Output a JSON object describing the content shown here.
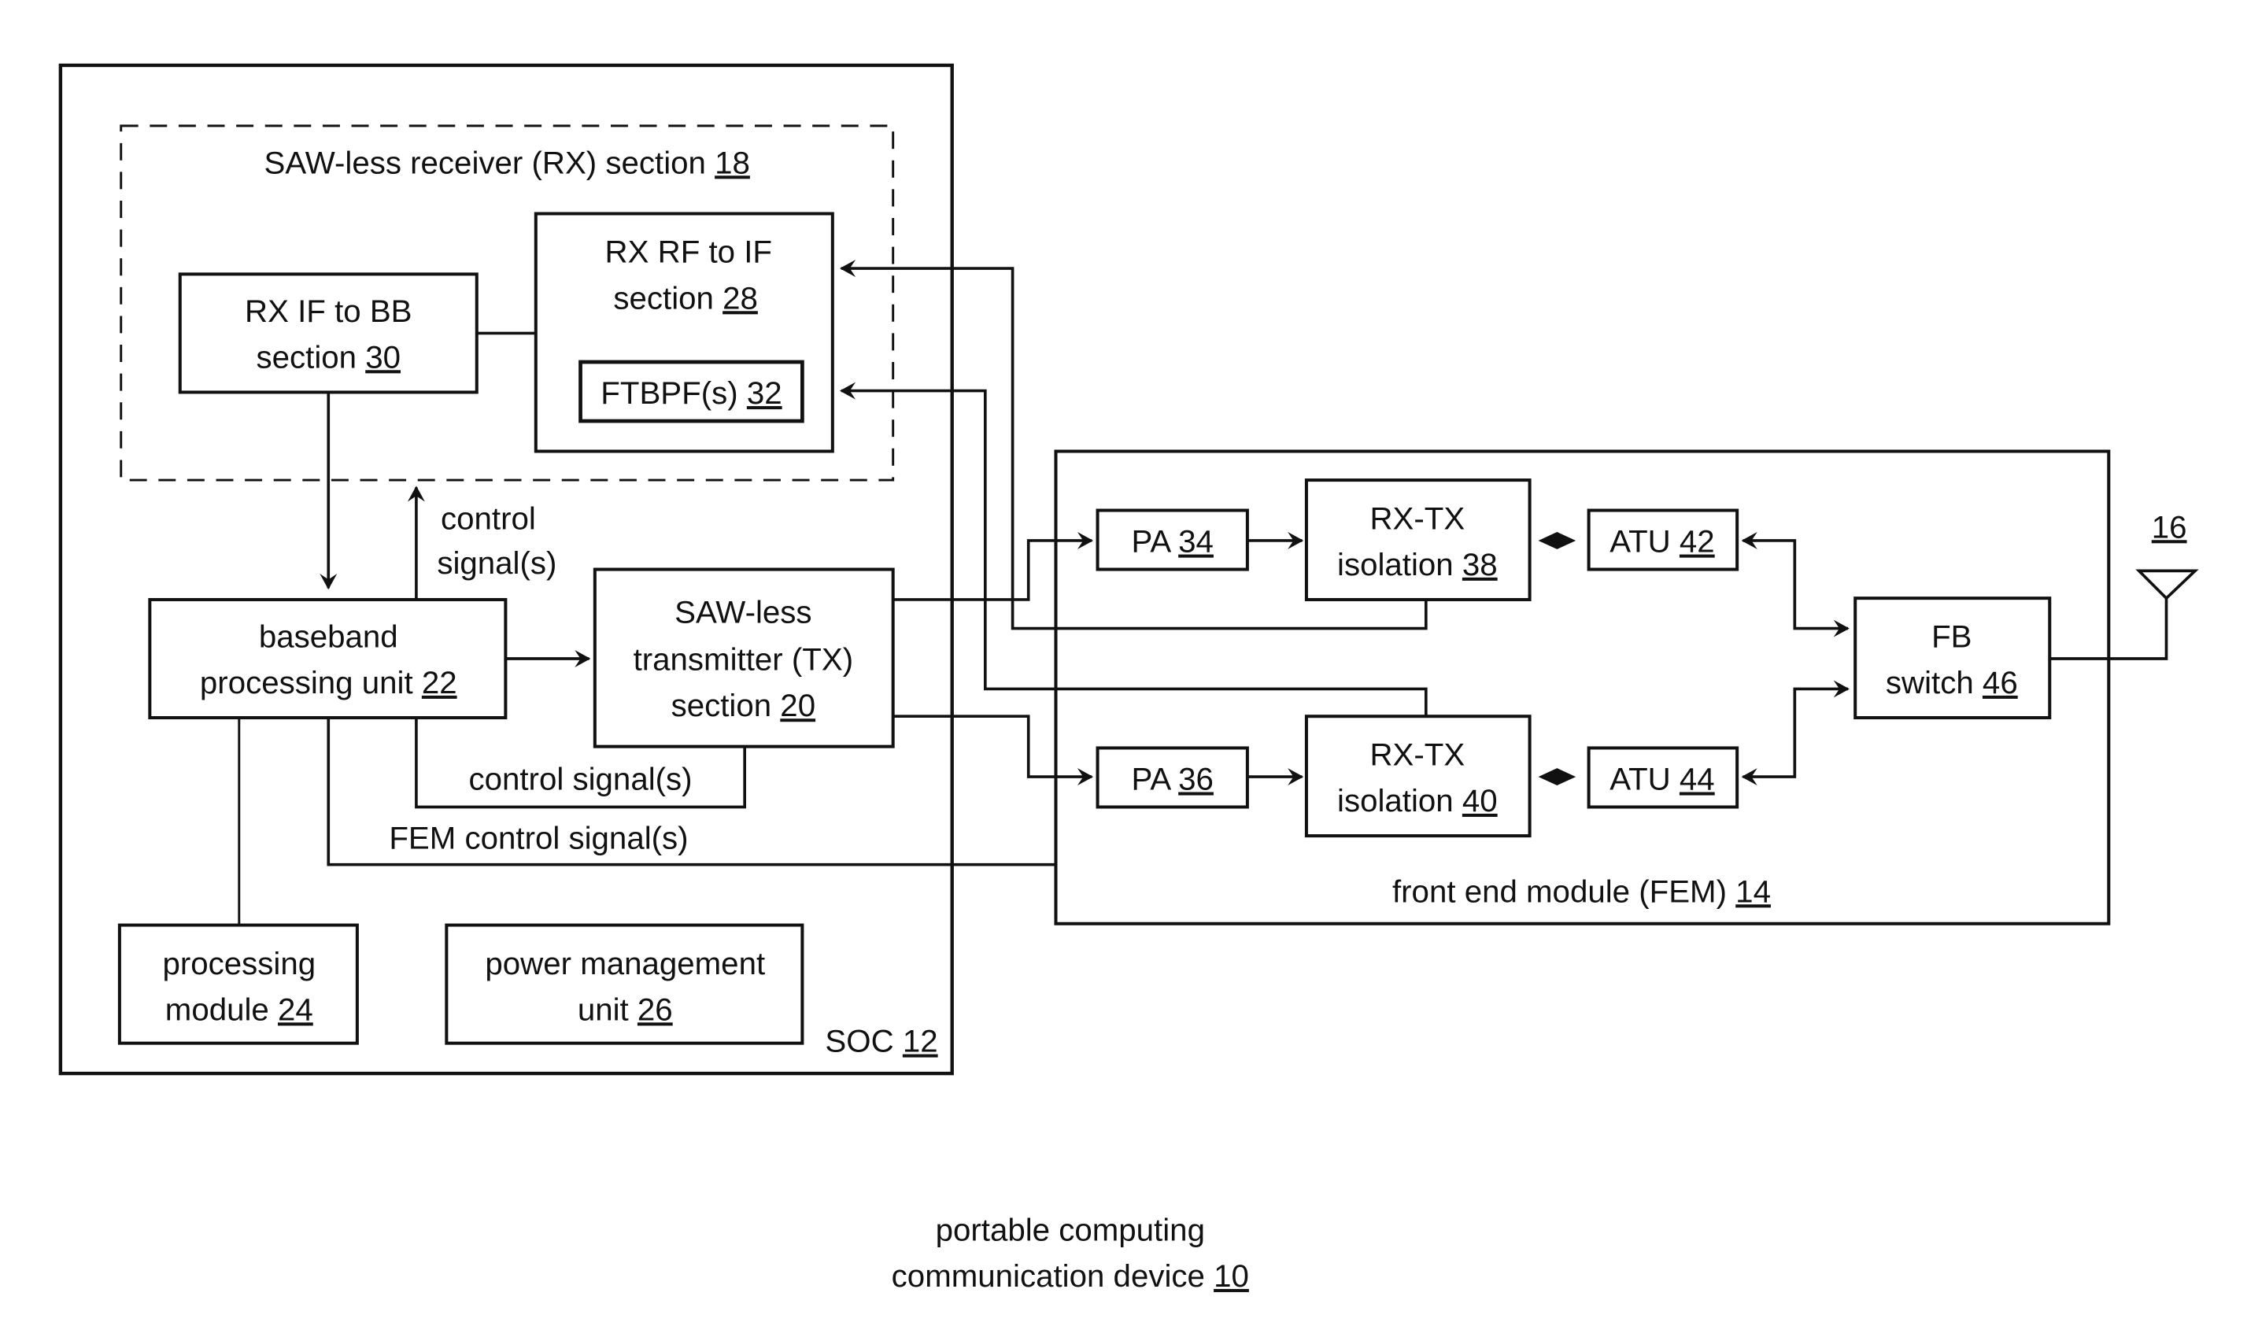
{
  "diagram": {
    "title": {
      "line1": "portable computing",
      "line2_text": "communication device ",
      "line2_ref": "10"
    },
    "soc": {
      "text": "SOC ",
      "ref": "12"
    },
    "rx_section": {
      "text": "SAW-less receiver (RX) section ",
      "ref": "18"
    },
    "rx_if_bb": {
      "line1": "RX IF to BB",
      "line2_text": "section ",
      "ref": "30"
    },
    "rx_rf_if": {
      "line1": "RX RF to IF",
      "line2_text": "section ",
      "ref": "28"
    },
    "ftbpf": {
      "text": "FTBPF(s) ",
      "ref": "32"
    },
    "baseband": {
      "line1": "baseband",
      "line2_text": "processing unit ",
      "ref": "22"
    },
    "tx_section": {
      "line1": "SAW-less",
      "line2": "transmitter (TX)",
      "line3_text": "section ",
      "ref": "20"
    },
    "control_rx": {
      "line1": "control",
      "line2": "signal(s)"
    },
    "control_tx": "control signal(s)",
    "fem_control": "FEM control signal(s)",
    "processing_module": {
      "line1": "processing",
      "line2_text": "module ",
      "ref": "24"
    },
    "power_mgmt": {
      "line1": "power management",
      "line2_text": "unit ",
      "ref": "26"
    },
    "fem": {
      "text": "front end module (FEM) ",
      "ref": "14"
    },
    "pa1": {
      "text": "PA ",
      "ref": "34"
    },
    "pa2": {
      "text": "PA ",
      "ref": "36"
    },
    "iso1": {
      "line1": "RX-TX",
      "line2_text": "isolation ",
      "ref": "38"
    },
    "iso2": {
      "line1": "RX-TX",
      "line2_text": "isolation ",
      "ref": "40"
    },
    "atu1": {
      "text": "ATU ",
      "ref": "42"
    },
    "atu2": {
      "text": "ATU ",
      "ref": "44"
    },
    "fb_switch": {
      "line1": "FB",
      "line2_text": "switch ",
      "ref": "46"
    },
    "antenna": {
      "ref": "16"
    }
  }
}
